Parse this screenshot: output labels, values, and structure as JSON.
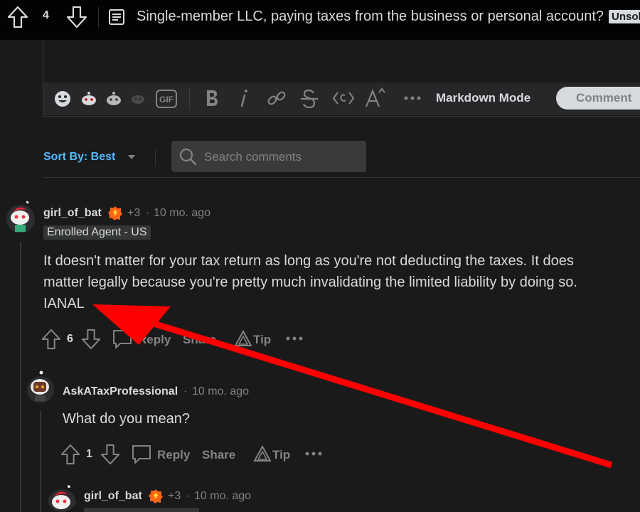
{
  "topbar": {
    "vote_count": "4",
    "post_title": "Single-member LLC, paying taxes from the business or personal account?",
    "tag": "Unsolved"
  },
  "editor": {
    "markdown_mode": "Markdown Mode",
    "comment_button": "Comment"
  },
  "sort": {
    "label": "Sort By: Best",
    "search_placeholder": "Search comments"
  },
  "comments": [
    {
      "username": "girl_of_bat",
      "karma": "+3",
      "separator": "·",
      "time": "10 mo. ago",
      "flair": "Enrolled Agent - US",
      "body_line1": "It doesn't matter for your tax return as long as you're not deducting the taxes. It does",
      "body_line2": "matter legally because you're pretty much invalidating the limited liability by doing so.",
      "body_line3": "IANAL",
      "votes": "6",
      "reply": "Reply",
      "share": "Share",
      "tip": "Tip"
    },
    {
      "username": "AskATaxProfessional",
      "separator": "·",
      "time": "10 mo. ago",
      "body": "What do you mean?",
      "votes": "1",
      "reply": "Reply",
      "share": "Share",
      "tip": "Tip"
    },
    {
      "username": "girl_of_bat",
      "karma": "+3",
      "separator": "·",
      "time": "10 mo. ago"
    }
  ],
  "colors": {
    "background": "#1a1a1b",
    "accent": "#4fbcff",
    "annotation_arrow": "#ff0000"
  }
}
